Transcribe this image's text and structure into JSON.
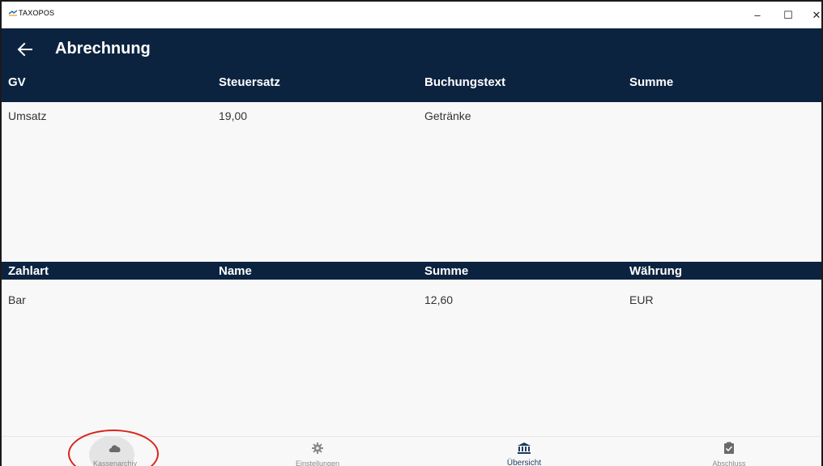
{
  "window": {
    "app_name": "TAXOPOS",
    "controls": {
      "minimize": "–",
      "maximize": "☐",
      "close": "✕"
    }
  },
  "header": {
    "title": "Abrechnung",
    "back_icon": "arrow-left-icon"
  },
  "colors": {
    "header_bg": "#0c2340",
    "body_bg": "#f8f8f8",
    "annotation": "#d9261c"
  },
  "table_gv": {
    "columns": [
      "GV",
      "Steuersatz",
      "Buchungstext",
      "Summe"
    ],
    "rows": [
      [
        "Umsatz",
        "19,00",
        "Getränke",
        ""
      ]
    ]
  },
  "table_payment": {
    "columns": [
      "Zahlart",
      "Name",
      "Summe",
      "Währung"
    ],
    "rows": [
      [
        "Bar",
        "",
        "12,60",
        "EUR"
      ]
    ]
  },
  "bottom_nav": {
    "items": [
      {
        "label": "Kassenarchiv",
        "icon": "cloud-icon",
        "active": false
      },
      {
        "label": "Einstellungen",
        "icon": "gear-icon",
        "active": false
      },
      {
        "label": "Übersicht",
        "icon": "bank-icon",
        "active": true
      },
      {
        "label": "Abschluss",
        "icon": "clipboard-check-icon",
        "active": false
      }
    ]
  }
}
